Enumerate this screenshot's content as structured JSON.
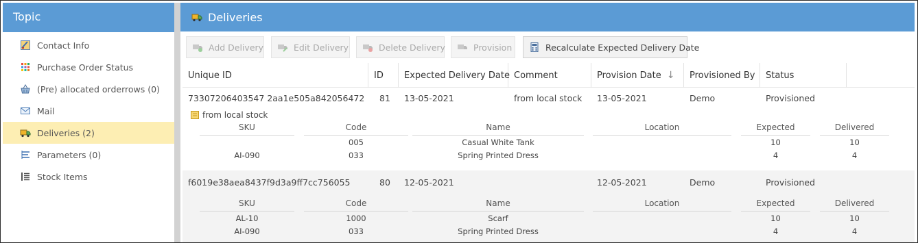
{
  "sidebar": {
    "title": "Topic",
    "items": [
      {
        "label": "Contact Info",
        "icon": "contact-card-icon"
      },
      {
        "label": "Purchase Order Status",
        "icon": "dots-grid-icon"
      },
      {
        "label": "(Pre) allocated orderrows (0)",
        "icon": "basket-icon"
      },
      {
        "label": "Mail",
        "icon": "envelope-icon"
      },
      {
        "label": "Deliveries (2)",
        "icon": "truck-icon"
      },
      {
        "label": "Parameters (0)",
        "icon": "parameters-list-icon"
      },
      {
        "label": "Stock Items",
        "icon": "stock-list-icon"
      }
    ],
    "active_index": 4
  },
  "main": {
    "title": "Deliveries",
    "toolbar": {
      "add": "Add Delivery",
      "edit": "Edit Delivery",
      "delete": "Delete Delivery",
      "provision": "Provision",
      "recalc": "Recalculate Expected Delivery Date"
    },
    "columns": [
      "Unique ID",
      "ID",
      "Expected Delivery Date",
      "Comment",
      "Provision Date",
      "Provisioned By",
      "Status"
    ],
    "sort_indicator": "↓",
    "subcolumns": [
      "SKU",
      "Code",
      "Name",
      "Location",
      "Expected",
      "Delivered"
    ],
    "deliveries": [
      {
        "unique_id": "73307206403547 2aa1e505a842056472",
        "id": "81",
        "expected_date": "13-05-2021",
        "comment": "from local stock",
        "provision_date": "13-05-2021",
        "provisioned_by": "Demo",
        "status": "Provisioned",
        "detail_comment": "from local stock",
        "items": [
          {
            "sku": "",
            "code": "005",
            "name": "Casual White Tank",
            "location": "",
            "expected": "10",
            "delivered": "10"
          },
          {
            "sku": "AI-090",
            "code": "033",
            "name": "Spring Printed Dress",
            "location": "",
            "expected": "4",
            "delivered": "4"
          }
        ]
      },
      {
        "unique_id": "f6019e38aea8437f9d3a9ff7cc756055",
        "id": "80",
        "expected_date": "12-05-2021",
        "comment": "",
        "provision_date": "12-05-2021",
        "provisioned_by": "Demo",
        "status": "Provisioned",
        "detail_comment": "",
        "items": [
          {
            "sku": "AL-10",
            "code": "1000",
            "name": "Scarf",
            "location": "",
            "expected": "10",
            "delivered": "10"
          },
          {
            "sku": "AI-090",
            "code": "033",
            "name": "Spring Printed Dress",
            "location": "",
            "expected": "4",
            "delivered": "4"
          }
        ]
      }
    ]
  },
  "colors": {
    "accent": "#5b9bd5",
    "active_item": "#fdeeb3"
  }
}
